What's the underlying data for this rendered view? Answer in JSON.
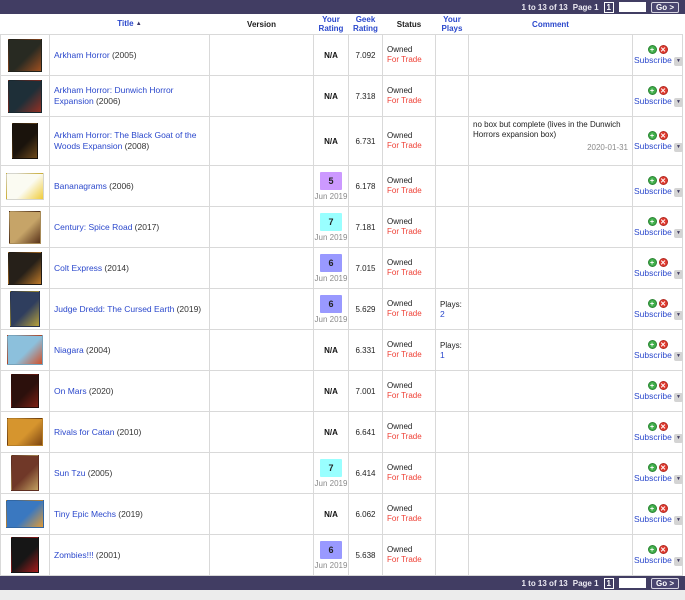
{
  "pager": {
    "range_label": "1 to 13 of 13",
    "page_label": "Page 1",
    "page_number": "1",
    "input_value": "",
    "go_label": "Go >"
  },
  "columns": {
    "title": "Title",
    "version": "Version",
    "your_rating": "Your Rating",
    "geek_rating": "Geek Rating",
    "status": "Status",
    "your_plays": "Your Plays",
    "comment": "Comment"
  },
  "icons": {
    "sort_asc": "▲",
    "add": "+",
    "remove": "✕",
    "subscribe_dropdown": "▼"
  },
  "labels": {
    "plays": "Plays:",
    "subscribe": "Subscribe"
  },
  "rating_colors": {
    "5": "#cc99ff",
    "6": "#9999ff",
    "7": "#99ffff"
  },
  "rows": [
    {
      "title": "Arkham Horror",
      "year": "(2005)",
      "version": "",
      "your_rating": "N/A",
      "rating_date": null,
      "geek_rating": "7.092",
      "status": [
        "Owned",
        "For Trade"
      ],
      "plays": null,
      "comment": null,
      "comment_date": null,
      "thumb": {
        "name": "arkham-horror-cover",
        "w": 34,
        "h": 33,
        "c1": "#282a22",
        "c2": "#a05020"
      }
    },
    {
      "title": "Arkham Horror: Dunwich Horror Expansion",
      "year": "(2006)",
      "version": "",
      "your_rating": "N/A",
      "rating_date": null,
      "geek_rating": "7.318",
      "status": [
        "Owned",
        "For Trade"
      ],
      "plays": null,
      "comment": null,
      "comment_date": null,
      "thumb": {
        "name": "dunwich-horror-cover",
        "w": 34,
        "h": 33,
        "c1": "#1e2f38",
        "c2": "#953124"
      }
    },
    {
      "title": "Arkham Horror: The Black Goat of the Woods Expansion",
      "year": "(2008)",
      "version": "",
      "your_rating": "N/A",
      "rating_date": null,
      "geek_rating": "6.731",
      "status": [
        "Owned",
        "For Trade"
      ],
      "plays": null,
      "comment": "no box but complete (lives in the Dunwich Horrors expansion box)",
      "comment_date": "2020-01-31",
      "thumb": {
        "name": "black-goat-cover",
        "w": 26,
        "h": 36,
        "c1": "#1a130c",
        "c2": "#6e4a1c"
      }
    },
    {
      "title": "Bananagrams",
      "year": "(2006)",
      "version": "",
      "your_rating": "5",
      "rating_date": "Jun 2019",
      "geek_rating": "6.178",
      "status": [
        "Owned",
        "For Trade"
      ],
      "plays": null,
      "comment": null,
      "comment_date": null,
      "thumb": {
        "name": "bananagrams-cover",
        "w": 38,
        "h": 27,
        "c1": "#fbfbf2",
        "c2": "#f0cc3a"
      }
    },
    {
      "title": "Century: Spice Road",
      "year": "(2017)",
      "version": "",
      "your_rating": "7",
      "rating_date": "Jun 2019",
      "geek_rating": "7.181",
      "status": [
        "Owned",
        "For Trade"
      ],
      "plays": null,
      "comment": null,
      "comment_date": null,
      "thumb": {
        "name": "century-spice-road-cover",
        "w": 32,
        "h": 33,
        "c1": "#c6a468",
        "c2": "#59331a"
      }
    },
    {
      "title": "Colt Express",
      "year": "(2014)",
      "version": "",
      "your_rating": "6",
      "rating_date": "Jun 2019",
      "geek_rating": "7.015",
      "status": [
        "Owned",
        "For Trade"
      ],
      "plays": null,
      "comment": null,
      "comment_date": null,
      "thumb": {
        "name": "colt-express-cover",
        "w": 34,
        "h": 33,
        "c1": "#262019",
        "c2": "#c07a28"
      }
    },
    {
      "title": "Judge Dredd: The Cursed Earth",
      "year": "(2019)",
      "version": "",
      "your_rating": "6",
      "rating_date": "Jun 2019",
      "geek_rating": "5.629",
      "status": [
        "Owned",
        "For Trade"
      ],
      "plays": "2",
      "comment": null,
      "comment_date": null,
      "thumb": {
        "name": "judge-dredd-cover",
        "w": 30,
        "h": 36,
        "c1": "#2f3e5e",
        "c2": "#b8a23a"
      }
    },
    {
      "title": "Niagara",
      "year": "(2004)",
      "version": "",
      "your_rating": "N/A",
      "rating_date": null,
      "geek_rating": "6.331",
      "status": [
        "Owned",
        "For Trade"
      ],
      "plays": "1",
      "comment": null,
      "comment_date": null,
      "thumb": {
        "name": "niagara-cover",
        "w": 36,
        "h": 30,
        "c1": "#8cc0dc",
        "c2": "#d0502a"
      }
    },
    {
      "title": "On Mars",
      "year": "(2020)",
      "version": "",
      "your_rating": "N/A",
      "rating_date": null,
      "geek_rating": "7.001",
      "status": [
        "Owned",
        "For Trade"
      ],
      "plays": null,
      "comment": null,
      "comment_date": null,
      "thumb": {
        "name": "on-mars-cover",
        "w": 28,
        "h": 34,
        "c1": "#2c100c",
        "c2": "#7e2014"
      }
    },
    {
      "title": "Rivals for Catan",
      "year": "(2010)",
      "version": "",
      "your_rating": "N/A",
      "rating_date": null,
      "geek_rating": "6.641",
      "status": [
        "Owned",
        "For Trade"
      ],
      "plays": null,
      "comment": null,
      "comment_date": null,
      "thumb": {
        "name": "rivals-for-catan-cover",
        "w": 36,
        "h": 28,
        "c1": "#d6952e",
        "c2": "#7e4612"
      }
    },
    {
      "title": "Sun Tzu",
      "year": "(2005)",
      "version": "",
      "your_rating": "7",
      "rating_date": "Jun 2019",
      "geek_rating": "6.414",
      "status": [
        "Owned",
        "For Trade"
      ],
      "plays": null,
      "comment": null,
      "comment_date": null,
      "thumb": {
        "name": "sun-tzu-cover",
        "w": 28,
        "h": 36,
        "c1": "#703828",
        "c2": "#c2a060"
      }
    },
    {
      "title": "Tiny Epic Mechs",
      "year": "(2019)",
      "version": "",
      "your_rating": "N/A",
      "rating_date": null,
      "geek_rating": "6.062",
      "status": [
        "Owned",
        "For Trade"
      ],
      "plays": null,
      "comment": null,
      "comment_date": null,
      "thumb": {
        "name": "tiny-epic-mechs-cover",
        "w": 38,
        "h": 28,
        "c1": "#3a78c0",
        "c2": "#e09a36"
      }
    },
    {
      "title": "Zombies!!!",
      "year": "(2001)",
      "version": "",
      "your_rating": "6",
      "rating_date": "Jun 2019",
      "geek_rating": "5.638",
      "status": [
        "Owned",
        "For Trade"
      ],
      "plays": null,
      "comment": null,
      "comment_date": null,
      "thumb": {
        "name": "zombies-cover",
        "w": 28,
        "h": 36,
        "c1": "#161616",
        "c2": "#a81c1c"
      }
    }
  ]
}
